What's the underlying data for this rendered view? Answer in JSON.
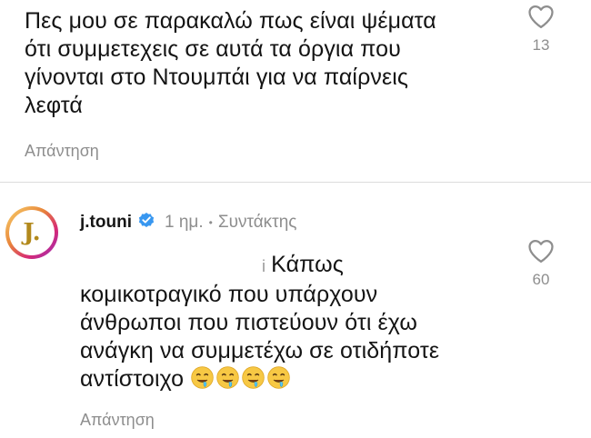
{
  "comments": [
    {
      "lines": [
        "Πες μου σε παρακαλώ πως είναι ψέματα",
        "ότι συμμετεχεις σε αυτά τα όργια που",
        "γίνονται στο Ντουμπάι για να παίρνεις",
        "λεφτά"
      ],
      "reply_label": "Απάντηση",
      "likes": "13",
      "like_icon": "heart-outline-icon"
    }
  ],
  "reply": {
    "avatar_letter": "J.",
    "username": "j.touni",
    "verified_icon": "verified-badge-icon",
    "time": "1 ημ.",
    "separator": "•",
    "role": "Συντάκτης",
    "marker": "i",
    "lines": [
      "Κάπως",
      "κομικοτραγικό που υπάρχουν",
      "άνθρωποι που πιστεύουν ότι έχω",
      "ανάγκη να συμμετέχω σε οτιδήποτε",
      "αντίστοιχο"
    ],
    "emoji_icon": "drooling-face-emoji",
    "emoji_count": 4,
    "reply_label": "Απάντηση",
    "likes": "60",
    "like_icon": "heart-outline-icon"
  },
  "colors": {
    "text": "#141414",
    "muted": "#8e8e8e",
    "verified": "#3897f0",
    "avatar_letter": "#b2891c"
  }
}
